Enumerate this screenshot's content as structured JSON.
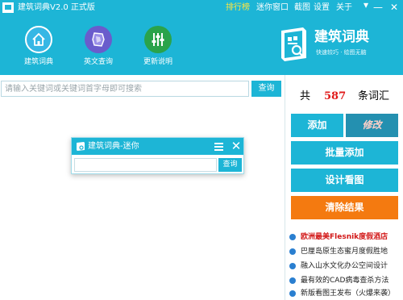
{
  "titlebar": {
    "title": "建筑词典V2.0  正式版",
    "links": [
      "排行榜",
      "迷你窗口",
      "截图",
      "设置",
      "关于"
    ],
    "minimize_glyph": "—",
    "close_glyph": "✕"
  },
  "nav": [
    {
      "label": "建筑词典",
      "icon": "home-icon"
    },
    {
      "label": "英文查询",
      "icon": "globe-icon"
    },
    {
      "label": "更新说明",
      "icon": "equalizer-icon"
    }
  ],
  "brand": {
    "name": "建筑词典",
    "slogan": "快速较巧 · 绘图无脑"
  },
  "search": {
    "placeholder": "请输入关键词或关键词首字母即可搜索",
    "value": "",
    "button": "查询"
  },
  "stats": {
    "prefix": "共",
    "count": "587",
    "suffix": "条词汇"
  },
  "actions": {
    "add": "添加",
    "edit": "修改",
    "batch_add": "批量添加",
    "design_view": "设计看图",
    "clear": "清除结果"
  },
  "news": [
    {
      "text": "欧洲最美Flesnik度假酒店",
      "hot": true
    },
    {
      "text": "巴厘岛原生态蜜月度假胜地",
      "hot": false
    },
    {
      "text": "融入山水文化办公空间设计",
      "hot": false
    },
    {
      "text": "最有效的CAD病毒查杀方法",
      "hot": false
    },
    {
      "text": "新版看图王发布（火爆来袭）",
      "hot": false
    }
  ],
  "mini_window": {
    "title": "建筑词典-迷你",
    "close_glyph": "✕",
    "input_value": "",
    "button": "查询"
  },
  "colors": {
    "header": "#1db5d6",
    "action": "#1db5d6",
    "edit_button": "#2490b0",
    "clear_button": "#f47a10",
    "count": "#e01818",
    "active_link": "#ffe640",
    "nav_home": "#36b7e5",
    "nav_english": "#6a5ccc",
    "nav_update": "#2aa34a"
  }
}
